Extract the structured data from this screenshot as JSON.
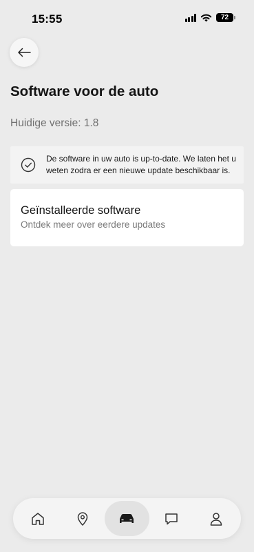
{
  "status_bar": {
    "time": "15:55",
    "battery": "72"
  },
  "header": {
    "back_icon": "arrow-left-icon",
    "title": "Software voor de auto"
  },
  "version": {
    "label": "Huidige versie: 1.8"
  },
  "info_banner": {
    "icon": "check-circle-icon",
    "text": "De software in uw auto is up-to-date. We laten het u weten zodra er een nieuwe update beschikbaar is."
  },
  "installed_card": {
    "title": "Geïnstalleerde software",
    "subtitle": "Ontdek meer over eerdere updates"
  },
  "bottom_nav": {
    "items": [
      {
        "icon": "home-icon",
        "active": false
      },
      {
        "icon": "location-pin-icon",
        "active": false
      },
      {
        "icon": "car-icon",
        "active": true
      },
      {
        "icon": "chat-icon",
        "active": false
      },
      {
        "icon": "profile-icon",
        "active": false
      }
    ]
  }
}
